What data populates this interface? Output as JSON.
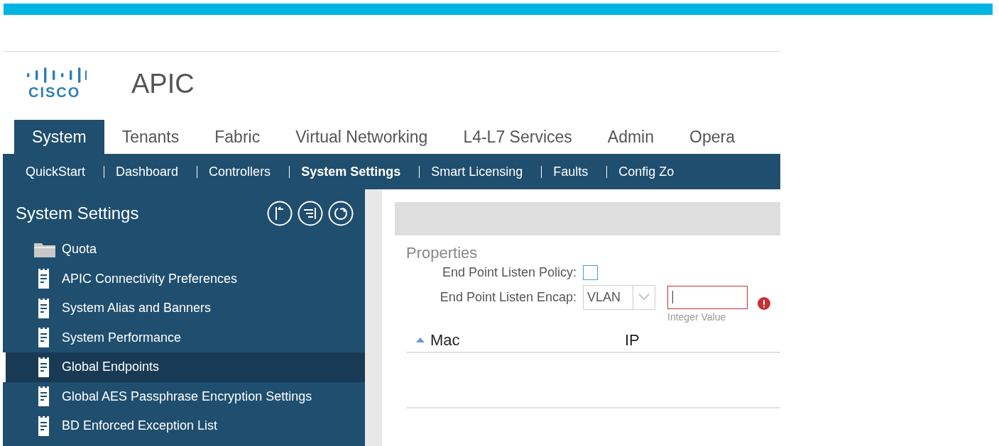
{
  "brand": {
    "logo_text": "CISCO",
    "product": "APIC"
  },
  "tabs": [
    {
      "label": "System",
      "selected": true
    },
    {
      "label": "Tenants",
      "selected": false
    },
    {
      "label": "Fabric",
      "selected": false
    },
    {
      "label": "Virtual Networking",
      "selected": false
    },
    {
      "label": "L4-L7 Services",
      "selected": false
    },
    {
      "label": "Admin",
      "selected": false
    },
    {
      "label": "Opera",
      "selected": false
    }
  ],
  "subnav": [
    {
      "label": "QuickStart",
      "selected": false
    },
    {
      "label": "Dashboard",
      "selected": false
    },
    {
      "label": "Controllers",
      "selected": false
    },
    {
      "label": "System Settings",
      "selected": true
    },
    {
      "label": "Smart Licensing",
      "selected": false
    },
    {
      "label": "Faults",
      "selected": false
    },
    {
      "label": "Config Zo",
      "selected": false
    }
  ],
  "sidebar": {
    "title": "System Settings",
    "tools": [
      {
        "kind": "collapse"
      },
      {
        "kind": "filter"
      },
      {
        "kind": "refresh"
      }
    ],
    "items": [
      {
        "label": "Quota",
        "kind": "folder",
        "selected": false
      },
      {
        "label": "APIC Connectivity Preferences",
        "kind": "policy",
        "selected": false
      },
      {
        "label": "System Alias and Banners",
        "kind": "policy",
        "selected": false
      },
      {
        "label": "System Performance",
        "kind": "policy",
        "selected": false
      },
      {
        "label": "Global Endpoints",
        "kind": "policy",
        "selected": true
      },
      {
        "label": "Global AES Passphrase Encryption Settings",
        "kind": "policy",
        "selected": false
      },
      {
        "label": "BD Enforced Exception List",
        "kind": "policy",
        "selected": false
      }
    ]
  },
  "properties": {
    "title": "Properties",
    "listen_policy": {
      "label": "End Point Listen Policy:",
      "checked": false
    },
    "listen_encap": {
      "label": "End Point Listen Encap:",
      "value": "VLAN",
      "help": "Integer Value",
      "invalid": true
    }
  },
  "table": {
    "columns": [
      {
        "label": "Mac",
        "sorted": true
      },
      {
        "label": "IP",
        "sorted": false
      }
    ]
  }
}
